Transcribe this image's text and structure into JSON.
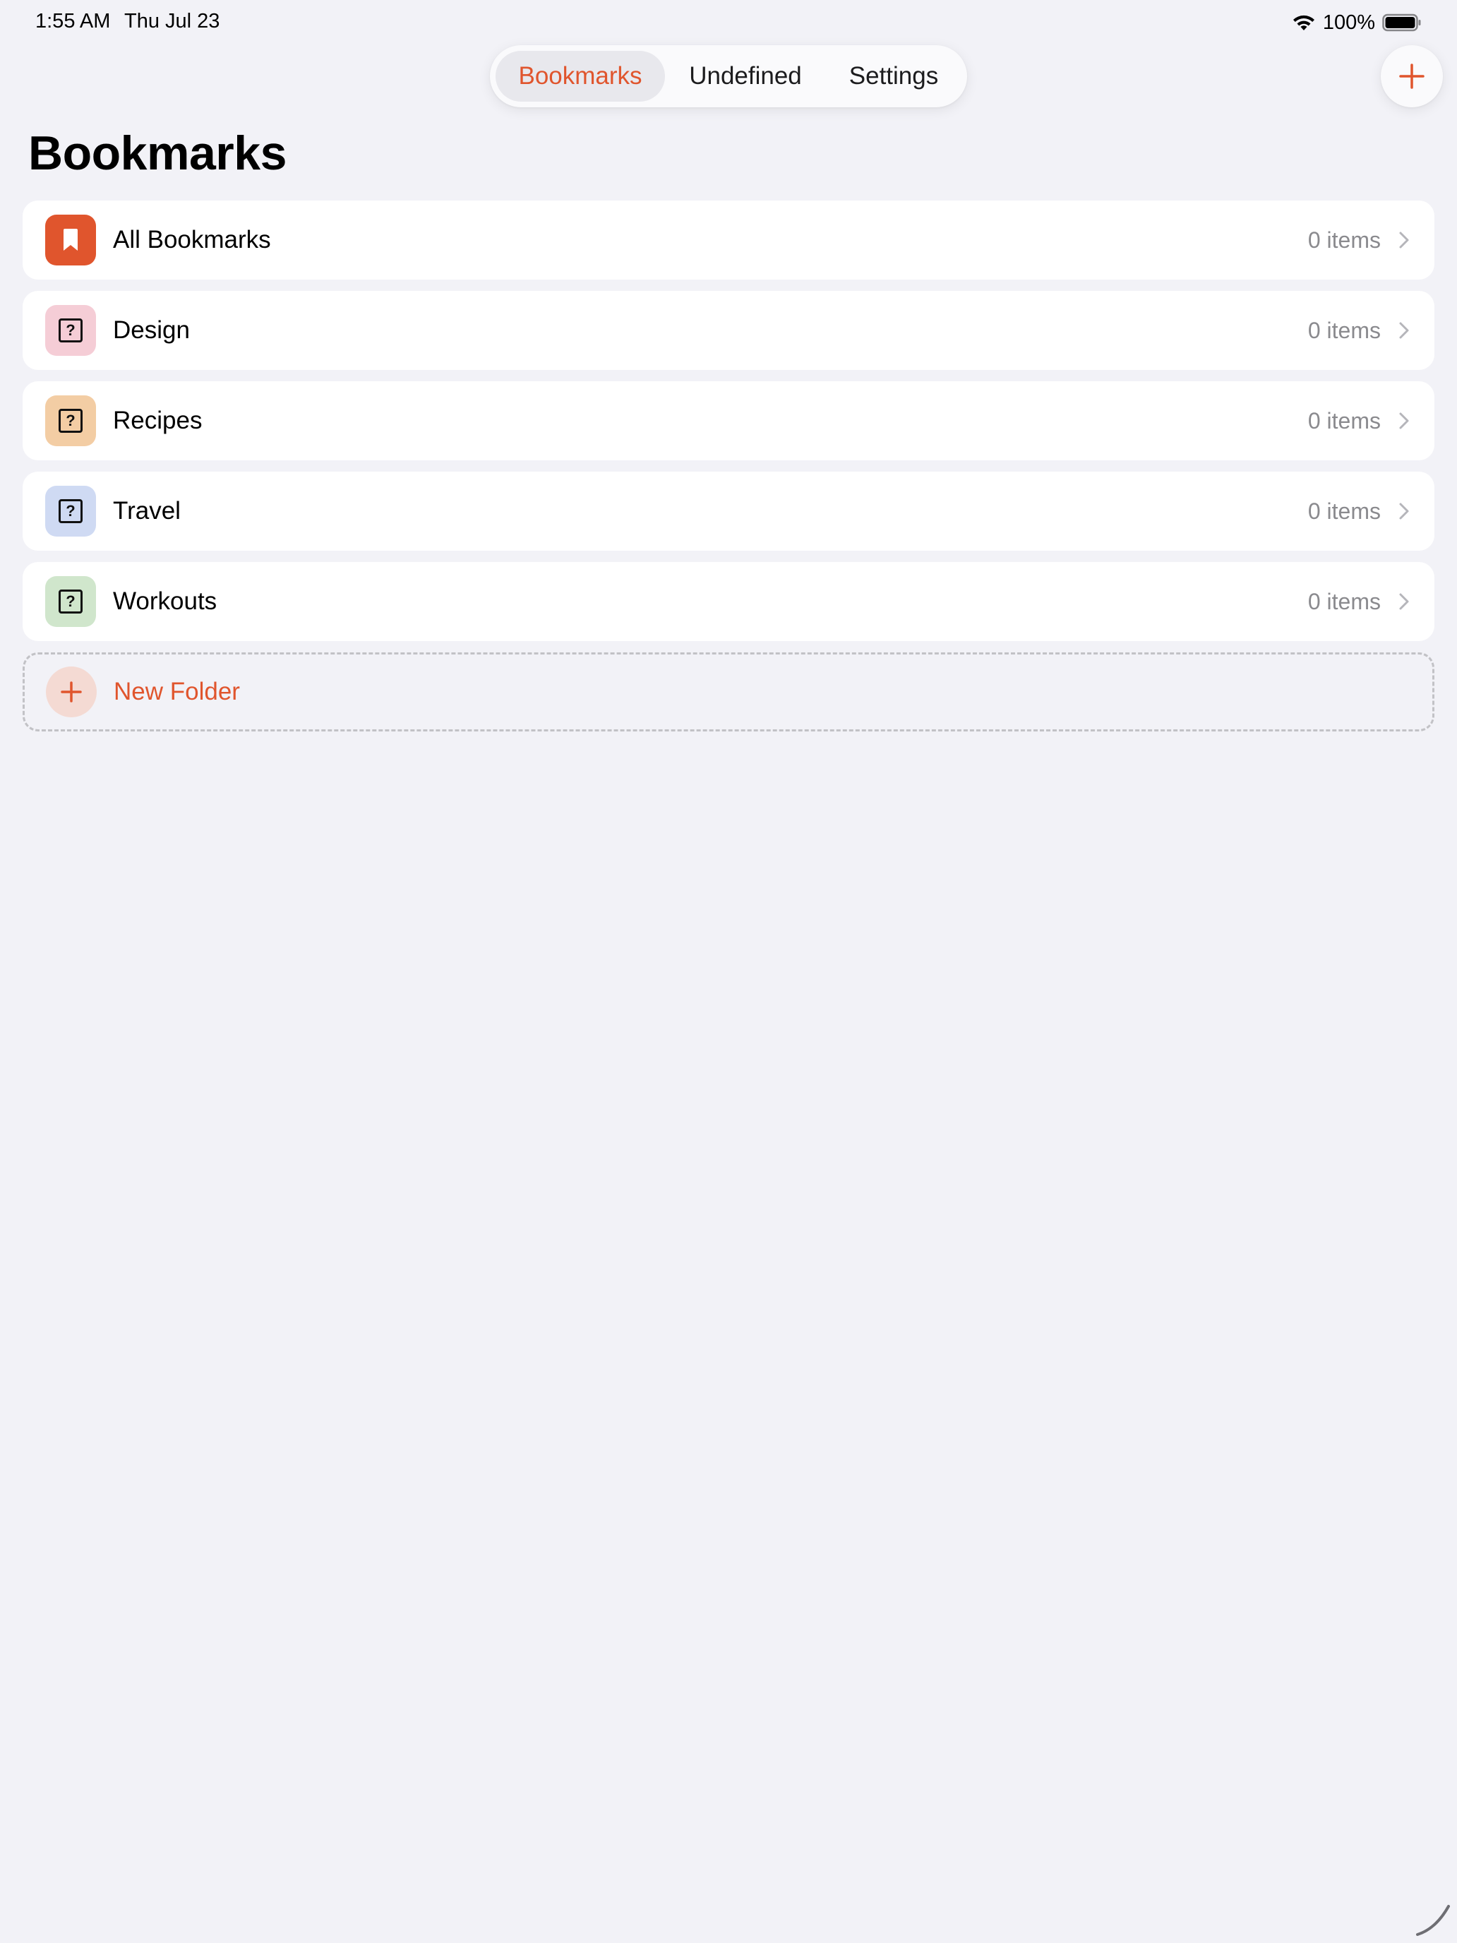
{
  "status_bar": {
    "time": "1:55 AM",
    "date": "Thu Jul 23",
    "battery": "100%"
  },
  "tabs": [
    {
      "label": "Bookmarks",
      "active": true
    },
    {
      "label": "Undefined",
      "active": false
    },
    {
      "label": "Settings",
      "active": false
    }
  ],
  "page": {
    "title": "Bookmarks"
  },
  "folders": [
    {
      "label": "All Bookmarks",
      "count": "0 items",
      "icon": "bookmark-icon",
      "icon_bg": "#e0552d"
    },
    {
      "label": "Design",
      "count": "0 items",
      "icon": "question-mark-icon",
      "icon_bg": "#f5cdd6"
    },
    {
      "label": "Recipes",
      "count": "0 items",
      "icon": "question-mark-icon",
      "icon_bg": "#f3cda4"
    },
    {
      "label": "Travel",
      "count": "0 items",
      "icon": "question-mark-icon",
      "icon_bg": "#cfdaf3"
    },
    {
      "label": "Workouts",
      "count": "0 items",
      "icon": "question-mark-icon",
      "icon_bg": "#d0e6cc"
    }
  ],
  "new_folder": {
    "label": "New Folder",
    "icon": "plus-icon"
  },
  "colors": {
    "accent": "#e0552d",
    "background": "#f2f2f7",
    "secondary_text": "#8a8a8e"
  }
}
